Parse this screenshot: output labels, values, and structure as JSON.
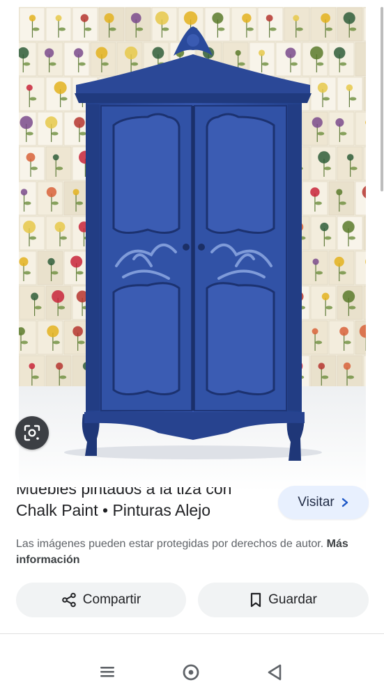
{
  "image": {
    "alt_icon": "armoire-photo"
  },
  "lens": {
    "icon": "lens-search-icon"
  },
  "result": {
    "title_line1": "Muebles pintados a la tiza con",
    "title_line2": "Chalk Paint • Pinturas Alejo",
    "visit_label": "Visitar",
    "copyright_text": "Las imágenes pueden estar protegidas por derechos de autor.",
    "copyright_more": "Más información"
  },
  "actions": {
    "share_label": "Compartir",
    "save_label": "Guardar"
  },
  "navbar": {
    "items": [
      "menu-icon",
      "home-circle-icon",
      "back-triangle-icon"
    ]
  },
  "colors": {
    "accent_button_bg": "#e8f0fe",
    "armoire_blue": "#2f4ea0",
    "chip_bg": "#f1f3f4"
  }
}
